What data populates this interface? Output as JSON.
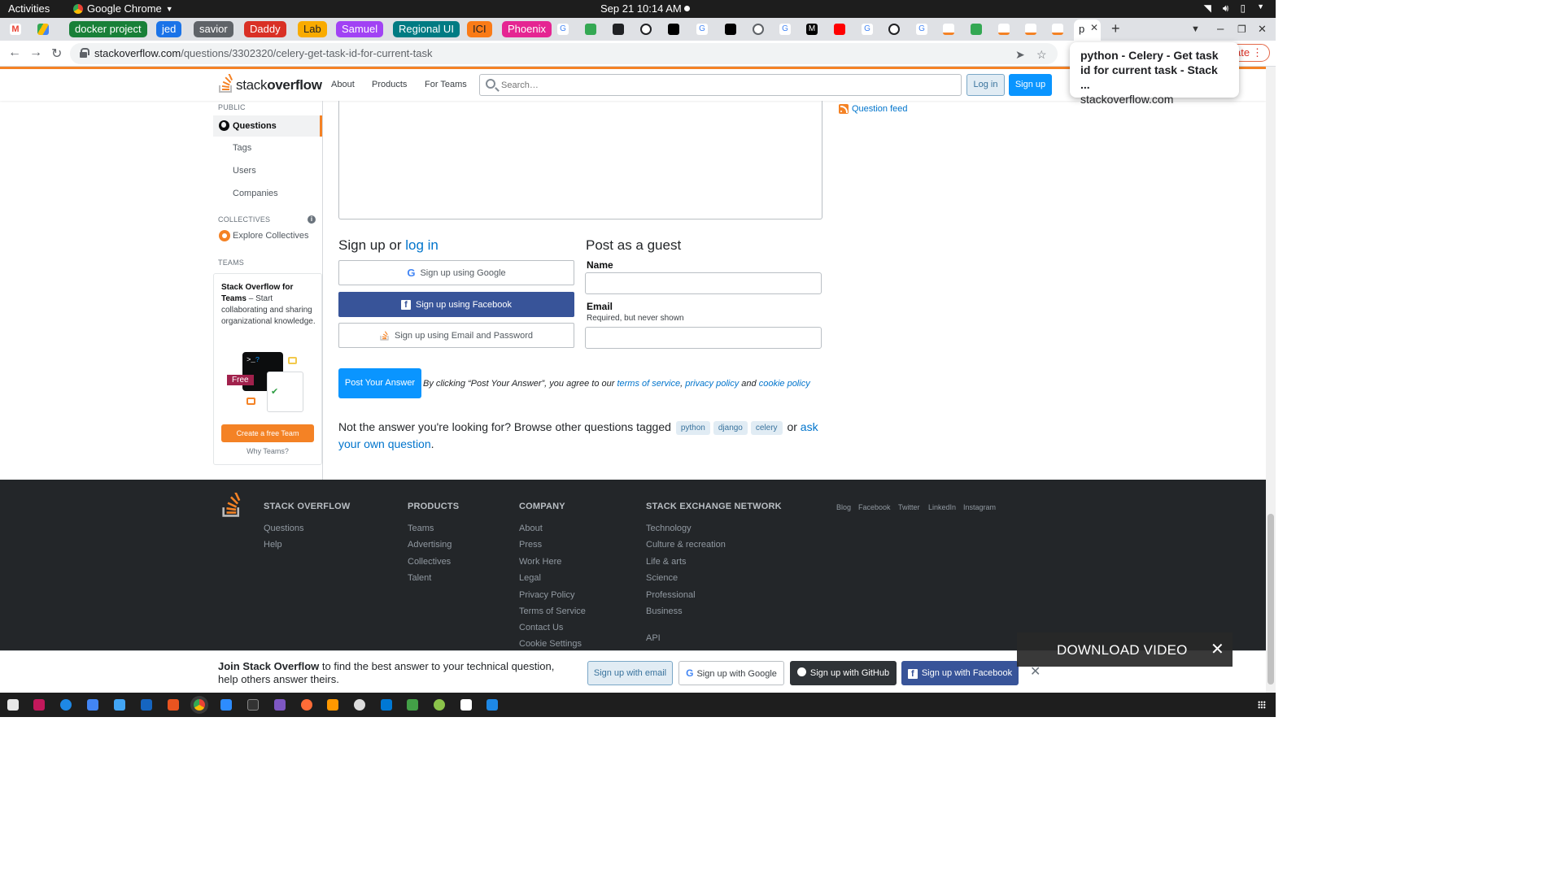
{
  "system_bar": {
    "activities": "Activities",
    "app_name": "Google Chrome",
    "datetime": "Sep 21  10:14 AM"
  },
  "tab_groups": [
    {
      "label": "docker project",
      "color": "#188038"
    },
    {
      "label": "jed",
      "color": "#1a73e8"
    },
    {
      "label": "savior",
      "color": "#5f6368"
    },
    {
      "label": "Daddy",
      "color": "#d93025"
    },
    {
      "label": "Lab",
      "color": "#f9ab00"
    },
    {
      "label": "Samuel",
      "color": "#a142f4"
    },
    {
      "label": "Regional UI",
      "color": "#007b83"
    },
    {
      "label": "ICI",
      "color": "#fa7b17"
    },
    {
      "label": "Phoenix",
      "color": "#e52592"
    }
  ],
  "active_tab": {
    "favicon_letter": "p",
    "close": "✕"
  },
  "browser": {
    "url_host": "stackoverflow.com",
    "url_path": "/questions/3302320/celery-get-task-id-for-current-task",
    "update_label": "ate"
  },
  "hovercard": {
    "title": "python - Celery - Get task id for current task - Stack ...",
    "domain": "stackoverflow.com"
  },
  "so_header": {
    "logo_text_a": "stack",
    "logo_text_b": "overflow",
    "nav": [
      "About",
      "Products",
      "For Teams"
    ],
    "search_placeholder": "Search…",
    "login": "Log in",
    "signup": "Sign up"
  },
  "left_nav": {
    "public_heading": "PUBLIC",
    "questions": "Questions",
    "items": [
      "Tags",
      "Users",
      "Companies"
    ],
    "collectives_heading": "COLLECTIVES",
    "explore_collectives": "Explore Collectives",
    "teams_heading": "TEAMS",
    "teams_title": "Stack Overflow for Teams",
    "teams_desc": " – Start collaborating and sharing organizational knowledge.",
    "free_badge": "Free",
    "create_team": "Create a free Team",
    "why_teams": "Why Teams?"
  },
  "answer_form": {
    "signup_text": "Sign up or ",
    "login_link": "log in",
    "google_btn": "Sign up using Google",
    "facebook_btn": "Sign up using Facebook",
    "email_btn": "Sign up using Email and Password",
    "guest_heading": "Post as a guest",
    "name_label": "Name",
    "email_label": "Email",
    "email_hint": "Required, but never shown",
    "post_button": "Post Your Answer",
    "agree_prefix": "By clicking “Post Your Answer”, you agree to our ",
    "terms": "terms of service",
    "privacy": "privacy policy",
    "and": " and ",
    "cookie": "cookie policy"
  },
  "not_answer": {
    "text": "Not the answer you're looking for? Browse other questions tagged ",
    "tags": [
      "python",
      "django",
      "celery"
    ],
    "or": " or ",
    "ask_link": "ask your own question",
    "period": "."
  },
  "sidebar_right": {
    "question_feed": "Question feed"
  },
  "footer": {
    "col1": {
      "heading": "STACK OVERFLOW",
      "links": [
        "Questions",
        "Help"
      ]
    },
    "col2": {
      "heading": "PRODUCTS",
      "links": [
        "Teams",
        "Advertising",
        "Collectives",
        "Talent"
      ]
    },
    "col3": {
      "heading": "COMPANY",
      "links": [
        "About",
        "Press",
        "Work Here",
        "Legal",
        "Privacy Policy",
        "Terms of Service",
        "Contact Us",
        "Cookie Settings"
      ]
    },
    "col4": {
      "heading": "STACK EXCHANGE NETWORK",
      "links": [
        "Technology",
        "Culture & recreation",
        "Life & arts",
        "Science",
        "Professional",
        "Business",
        "API"
      ]
    },
    "social": [
      "Blog",
      "Facebook",
      "Twitter",
      "LinkedIn",
      "Instagram"
    ]
  },
  "join_bar": {
    "bold": "Join Stack Overflow",
    "text": " to find the best answer to your technical question, help others answer theirs.",
    "email": "Sign up with email",
    "google": "Sign up with Google",
    "github": "Sign up with GitHub",
    "facebook": "Sign up with Facebook",
    "close": "✕"
  },
  "download_video": {
    "label": "DOWNLOAD VIDEO",
    "close": "✕"
  },
  "colors": {
    "so_orange": "#f48225",
    "so_blue": "#0a95ff",
    "link": "#0074cc",
    "footer_bg": "#232629"
  }
}
